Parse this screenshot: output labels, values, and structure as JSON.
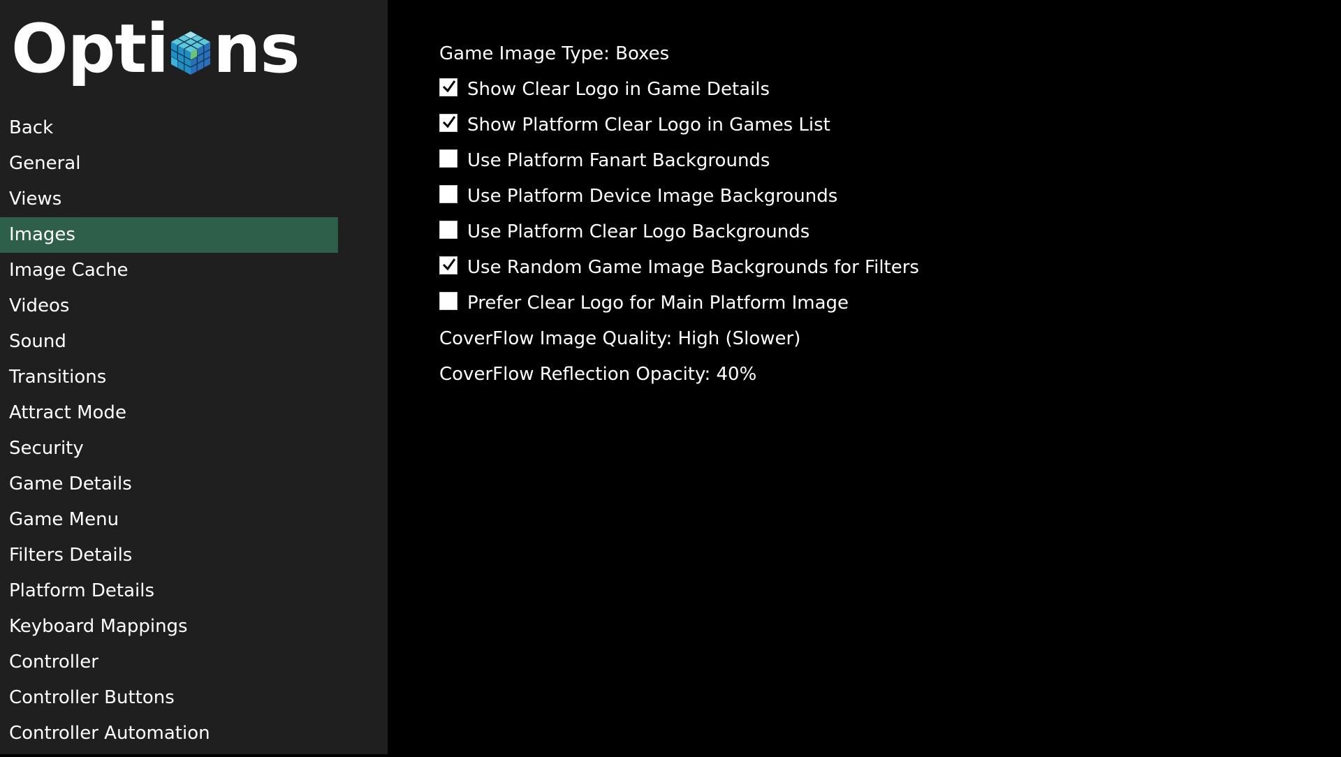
{
  "header": {
    "title_before": "Opti",
    "title_after": "ns",
    "logo_icon": "cube-icon"
  },
  "sidebar": {
    "items": [
      {
        "label": "Back",
        "selected": false
      },
      {
        "label": "General",
        "selected": false
      },
      {
        "label": "Views",
        "selected": false
      },
      {
        "label": "Images",
        "selected": true
      },
      {
        "label": "Image Cache",
        "selected": false
      },
      {
        "label": "Videos",
        "selected": false
      },
      {
        "label": "Sound",
        "selected": false
      },
      {
        "label": "Transitions",
        "selected": false
      },
      {
        "label": "Attract Mode",
        "selected": false
      },
      {
        "label": "Security",
        "selected": false
      },
      {
        "label": "Game Details",
        "selected": false
      },
      {
        "label": "Game Menu",
        "selected": false
      },
      {
        "label": "Filters Details",
        "selected": false
      },
      {
        "label": "Platform Details",
        "selected": false
      },
      {
        "label": "Keyboard Mappings",
        "selected": false
      },
      {
        "label": "Controller",
        "selected": false
      },
      {
        "label": "Controller Buttons",
        "selected": false
      },
      {
        "label": "Controller Automation",
        "selected": false
      }
    ]
  },
  "settings": {
    "game_image_type": "Game Image Type: Boxes",
    "options": [
      {
        "label": "Show Clear Logo in Game Details",
        "checked": true
      },
      {
        "label": "Show Platform Clear Logo in Games List",
        "checked": true
      },
      {
        "label": "Use Platform Fanart Backgrounds",
        "checked": false
      },
      {
        "label": "Use Platform Device Image Backgrounds",
        "checked": false
      },
      {
        "label": "Use Platform Clear Logo Backgrounds",
        "checked": false
      },
      {
        "label": "Use Random Game Image Backgrounds for Filters",
        "checked": true
      },
      {
        "label": "Prefer Clear Logo for Main Platform Image",
        "checked": false
      }
    ],
    "coverflow_quality": "CoverFlow Image Quality: High (Slower)",
    "coverflow_opacity": "CoverFlow Reflection Opacity: 40%"
  },
  "colors": {
    "sidebar_bg": "#1f1f1f",
    "content_bg": "#000000",
    "selected_bg": "#2e5f4a",
    "text": "#ffffff"
  }
}
